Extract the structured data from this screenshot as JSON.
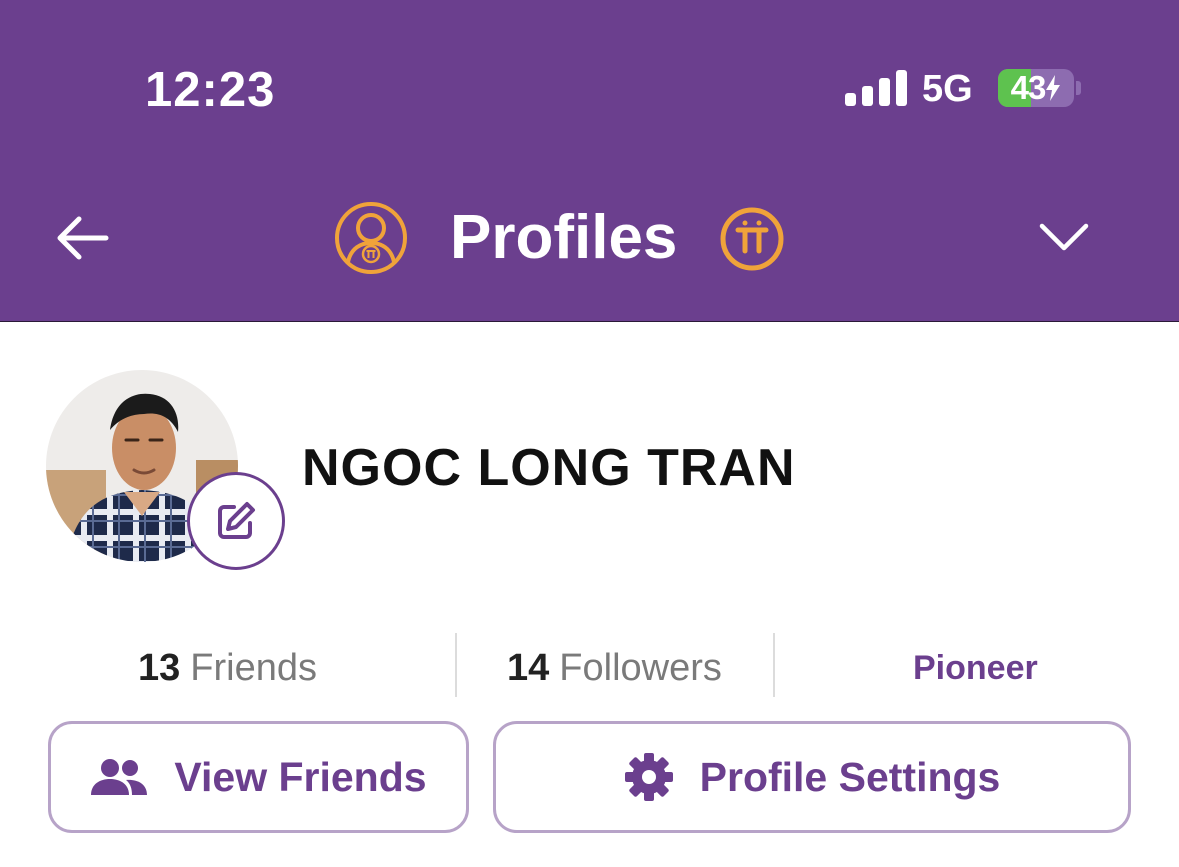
{
  "status_bar": {
    "time": "12:23",
    "network": "5G",
    "battery_percent": "43",
    "battery_level": 0.43
  },
  "header": {
    "title": "Profiles",
    "back_icon": "arrow-left-icon",
    "profile_icon": "pi-user-icon",
    "pi_icon": "pi-coin-icon",
    "dropdown_icon": "chevron-down-icon"
  },
  "profile": {
    "name": "NGOC LONG TRAN",
    "avatar_icon": "user-photo",
    "edit_icon": "pencil-edit-icon"
  },
  "stats": {
    "friends_count": "13",
    "friends_label": "Friends",
    "followers_count": "14",
    "followers_label": "Followers",
    "role": "Pioneer"
  },
  "actions": {
    "view_friends_label": "View Friends",
    "view_friends_icon": "people-icon",
    "profile_settings_label": "Profile Settings",
    "profile_settings_icon": "gear-icon"
  },
  "colors": {
    "brand_purple": "#6b3f8e",
    "accent_gold": "#f0a33a",
    "battery_green": "#5ec24f"
  }
}
